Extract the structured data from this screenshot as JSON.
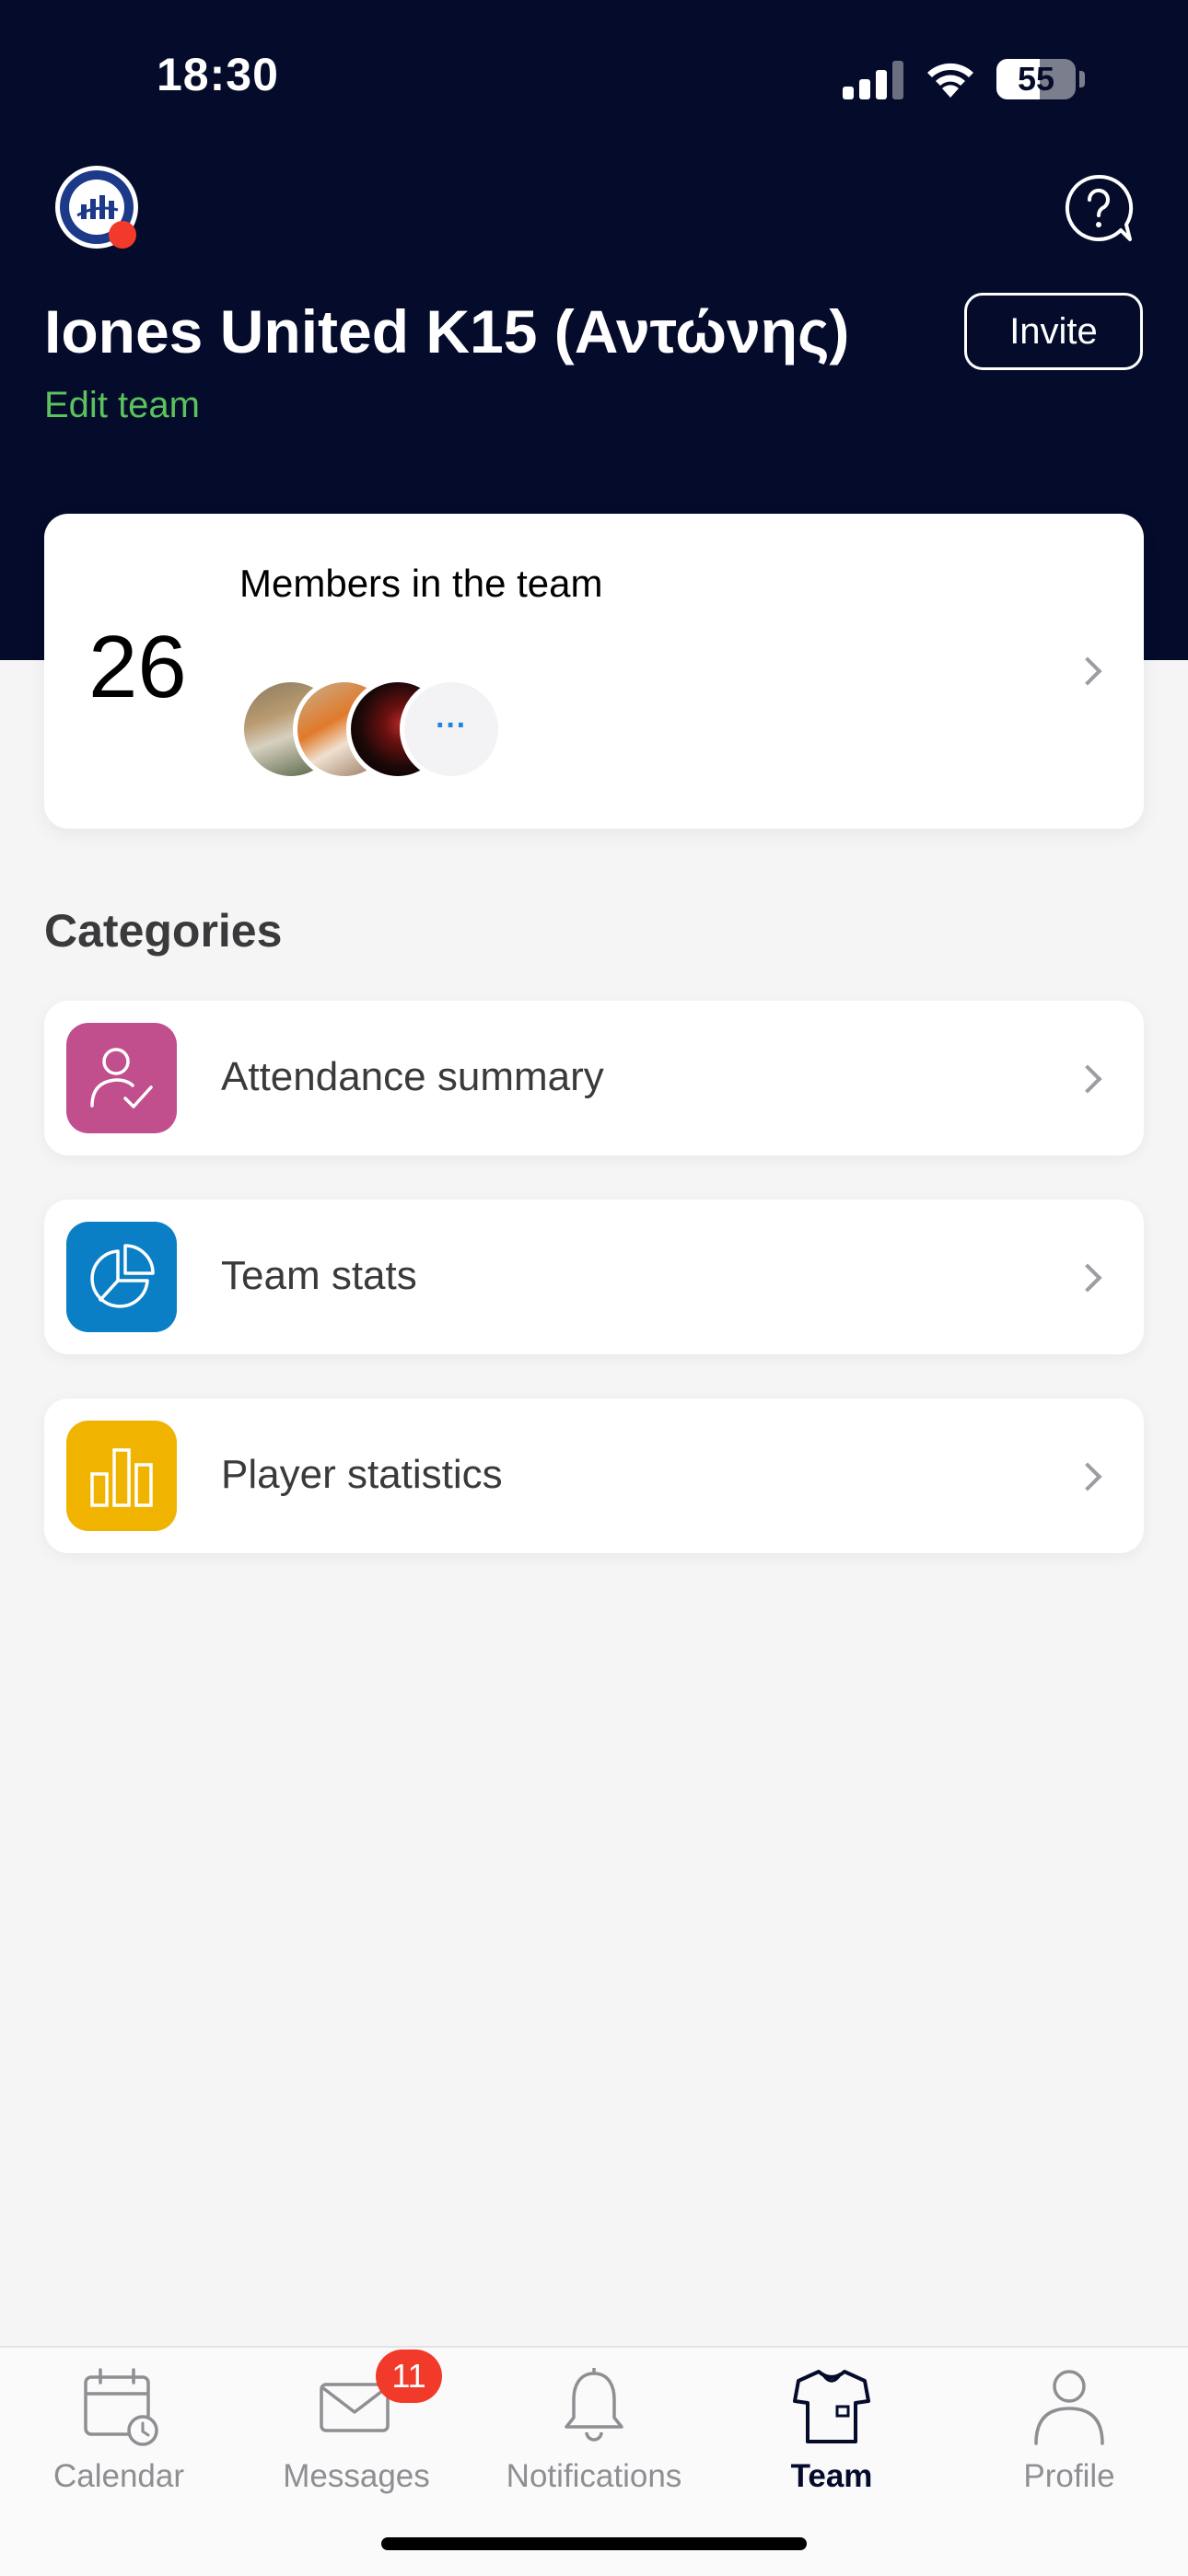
{
  "status_bar": {
    "time": "18:30",
    "battery_percent": "55",
    "battery_level": 0.55
  },
  "header": {
    "team_name": "Iones United K15 (Αντώνης)",
    "edit_team_label": "Edit team",
    "invite_label": "Invite",
    "logo_icon": "team-crest-icon",
    "help_icon": "help-chat-icon"
  },
  "members": {
    "count": "26",
    "title": "Members in the team",
    "more_label": "···"
  },
  "categories": {
    "title": "Categories",
    "items": [
      {
        "label": "Attendance summary",
        "icon": "user-check-icon",
        "color": "#c14f8e"
      },
      {
        "label": "Team stats",
        "icon": "pie-chart-icon",
        "color": "#0b7fc6"
      },
      {
        "label": "Player statistics",
        "icon": "bar-chart-icon",
        "color": "#f0b400"
      }
    ]
  },
  "tab_bar": {
    "tabs": [
      {
        "label": "Calendar",
        "icon": "calendar-icon"
      },
      {
        "label": "Messages",
        "icon": "envelope-icon",
        "badge": "11"
      },
      {
        "label": "Notifications",
        "icon": "bell-icon"
      },
      {
        "label": "Team",
        "icon": "jersey-icon",
        "active": true
      },
      {
        "label": "Profile",
        "icon": "person-icon"
      }
    ]
  },
  "colors": {
    "header_bg": "#050c2b",
    "accent_green": "#5bc25e",
    "badge_red": "#f23a2a"
  }
}
